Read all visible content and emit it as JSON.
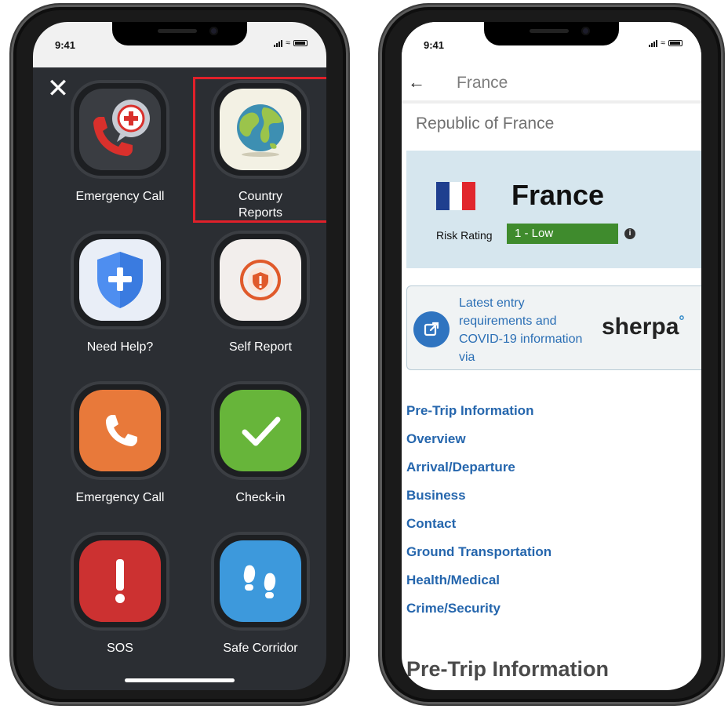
{
  "left_screen": {
    "status_time": "9:41",
    "close_label": "✕",
    "tiles": [
      {
        "label": "Emergency Call"
      },
      {
        "label": "Country\nReports"
      },
      {
        "label": "Need Help?"
      },
      {
        "label": "Self Report"
      },
      {
        "label": "Emergency Call"
      },
      {
        "label": "Check-in"
      },
      {
        "label": "SOS"
      },
      {
        "label": "Safe Corridor"
      }
    ],
    "tile_colors": {
      "country": "#f3f1e4",
      "need_help": "#e9eef7",
      "self_report": "#f2eeec",
      "emergency_orange": "#e8793a",
      "checkin_green": "#67b53a",
      "sos_red": "#cc3131",
      "safe_blue": "#3d99dc"
    },
    "highlight_color": "#e0202a"
  },
  "right_screen": {
    "status_time": "9:41",
    "back_icon": "←",
    "header_title": "France",
    "subtitle": "Republic of France",
    "country_card": {
      "name": "France",
      "flag_colors": [
        "#1f3f8f",
        "#ffffff",
        "#e1262d"
      ],
      "risk_label": "Risk Rating",
      "risk_value": "1 - Low",
      "risk_color": "#3f8b2d",
      "info_icon": "i"
    },
    "sherpa_card": {
      "text": "Latest entry requirements and COVID-19 information via",
      "logo": "sherpa",
      "logo_mark": "°"
    },
    "links": [
      "Pre-Trip Information",
      "Overview",
      "Arrival/Departure",
      "Business",
      "Contact",
      "Ground Transportation",
      "Health/Medical",
      "Crime/Security"
    ],
    "section_heading": "Pre-Trip Information"
  }
}
